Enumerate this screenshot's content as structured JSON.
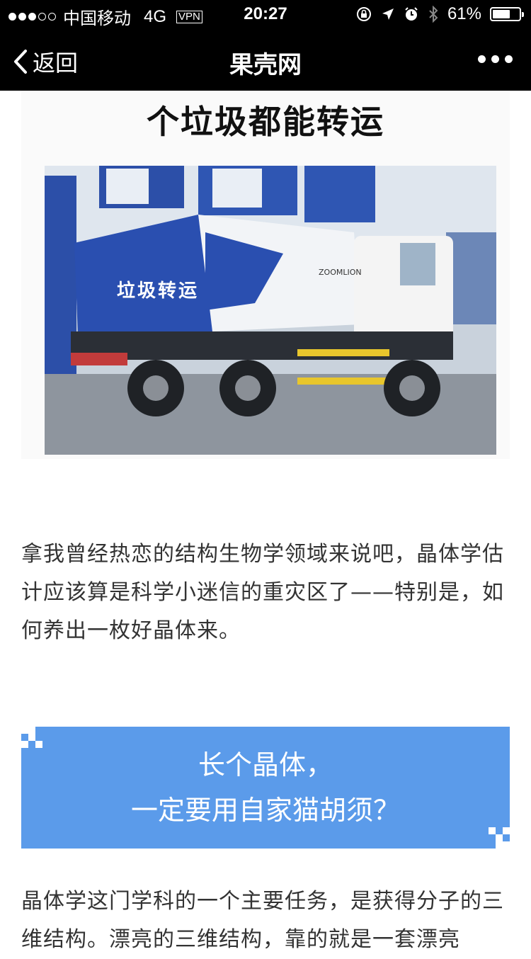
{
  "status_bar": {
    "signal_filled": 3,
    "signal_total": 5,
    "carrier": "中国移动",
    "network": "4G",
    "vpn": "VPN",
    "time": "20:27",
    "battery": "61%",
    "battery_level": 0.61
  },
  "nav": {
    "back_label": "返回",
    "title": "果壳网"
  },
  "article": {
    "image_caption": "个垃圾都能转运",
    "truck_side_text": "垃圾转运",
    "truck_brand_text": "ZOOMLION",
    "paragraph1": "拿我曾经热恋的结构生物学领域来说吧，晶体学估计应该算是科学小迷信的重灾区了——特别是，如何养出一枚好晶体来。",
    "heading_line1": "长个晶体，",
    "heading_line2": "一定要用自家猫胡须？",
    "paragraph2": "晶体学这门学科的一个主要任务，是获得分子的三维结构。漂亮的三维结构，靠的就是一套漂亮"
  },
  "colors": {
    "bar_bg": "#000000",
    "heading_box": "#5b9bea",
    "body_text": "#333333"
  }
}
